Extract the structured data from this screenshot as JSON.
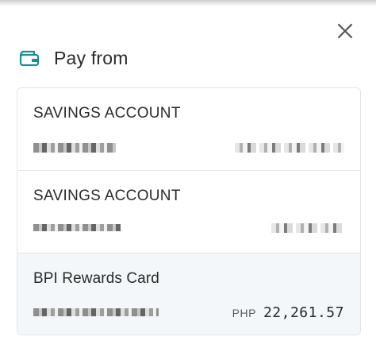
{
  "dialog": {
    "title": "Pay from",
    "close_icon": "close-icon",
    "wallet_icon": "wallet-icon",
    "accent_color": "#1d8c93"
  },
  "accounts": [
    {
      "name": "SAVINGS ACCOUNT",
      "number": "redacted",
      "balance": "redacted",
      "selected": false
    },
    {
      "name": "SAVINGS ACCOUNT",
      "number": "redacted",
      "balance": "redacted",
      "selected": false
    },
    {
      "name": "BPI Rewards Card",
      "number": "redacted",
      "currency": "PHP",
      "balance": "22,261.57",
      "selected": true
    }
  ]
}
